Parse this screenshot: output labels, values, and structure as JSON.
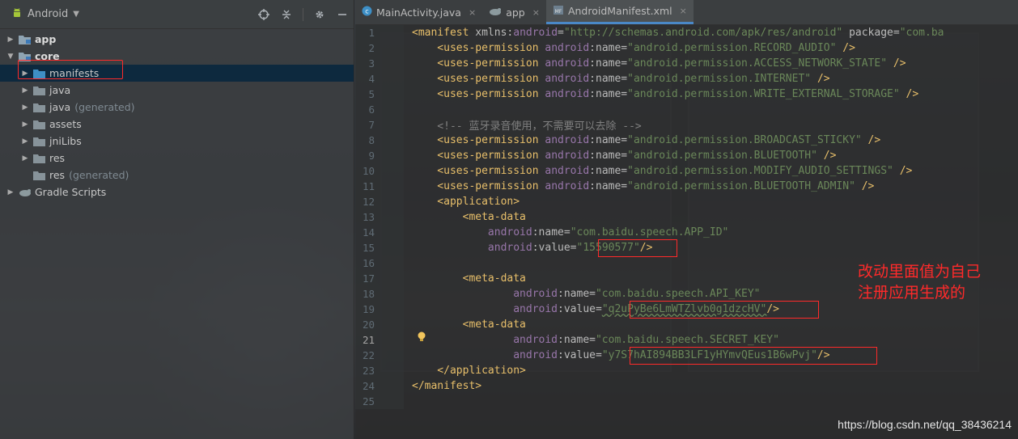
{
  "project": {
    "view_title": "Android",
    "tree": [
      {
        "label": "app",
        "bold": true,
        "expanded": false,
        "depth": 0
      },
      {
        "label": "core",
        "bold": true,
        "expanded": true,
        "depth": 0
      },
      {
        "label": "manifests",
        "depth": 1,
        "selected": true
      },
      {
        "label": "java",
        "depth": 1
      },
      {
        "label": "java",
        "muted": "(generated)",
        "depth": 1
      },
      {
        "label": "assets",
        "depth": 1
      },
      {
        "label": "jniLibs",
        "depth": 1
      },
      {
        "label": "res",
        "depth": 1
      },
      {
        "label": "res",
        "muted": "(generated)",
        "depth": 1,
        "no_arrow": true
      },
      {
        "label": "Gradle Scripts",
        "depth": 0
      }
    ]
  },
  "tabs": [
    {
      "label": "MainActivity.java"
    },
    {
      "label": "app"
    },
    {
      "label": "AndroidManifest.xml",
      "active": true
    }
  ],
  "editor": {
    "current_line": 21,
    "lines": [
      [
        [
          "t",
          "<manifest "
        ],
        [
          "an",
          "xmlns:"
        ],
        [
          "ns",
          "android"
        ],
        [
          "an",
          "="
        ],
        [
          "av",
          "\"http://schemas.android.com/apk/res/android\""
        ],
        [
          "an",
          " package="
        ],
        [
          "av",
          "\"com.ba"
        ]
      ],
      [
        [
          "t",
          "    <uses-permission "
        ],
        [
          "ns",
          "android"
        ],
        [
          "an",
          ":name="
        ],
        [
          "av",
          "\"android.permission.RECORD_AUDIO\""
        ],
        [
          "t",
          " />"
        ]
      ],
      [
        [
          "t",
          "    <uses-permission "
        ],
        [
          "ns",
          "android"
        ],
        [
          "an",
          ":name="
        ],
        [
          "av",
          "\"android.permission.ACCESS_NETWORK_STATE\""
        ],
        [
          "t",
          " />"
        ]
      ],
      [
        [
          "t",
          "    <uses-permission "
        ],
        [
          "ns",
          "android"
        ],
        [
          "an",
          ":name="
        ],
        [
          "av",
          "\"android.permission.INTERNET\""
        ],
        [
          "t",
          " />"
        ]
      ],
      [
        [
          "t",
          "    <uses-permission "
        ],
        [
          "ns",
          "android"
        ],
        [
          "an",
          ":name="
        ],
        [
          "av",
          "\"android.permission.WRITE_EXTERNAL_STORAGE\""
        ],
        [
          "t",
          " />"
        ]
      ],
      [],
      [
        [
          "cm",
          "    <!-- 蓝牙录音使用，不需要可以去除 -->"
        ]
      ],
      [
        [
          "t",
          "    <uses-permission "
        ],
        [
          "ns",
          "android"
        ],
        [
          "an",
          ":name="
        ],
        [
          "av",
          "\"android.permission.BROADCAST_STICKY\""
        ],
        [
          "t",
          " />"
        ]
      ],
      [
        [
          "t",
          "    <uses-permission "
        ],
        [
          "ns",
          "android"
        ],
        [
          "an",
          ":name="
        ],
        [
          "av",
          "\"android.permission.BLUETOOTH\""
        ],
        [
          "t",
          " />"
        ]
      ],
      [
        [
          "t",
          "    <uses-permission "
        ],
        [
          "ns",
          "android"
        ],
        [
          "an",
          ":name="
        ],
        [
          "av",
          "\"android.permission.MODIFY_AUDIO_SETTINGS\""
        ],
        [
          "t",
          " />"
        ]
      ],
      [
        [
          "t",
          "    <uses-permission "
        ],
        [
          "ns",
          "android"
        ],
        [
          "an",
          ":name="
        ],
        [
          "av",
          "\"android.permission.BLUETOOTH_ADMIN\""
        ],
        [
          "t",
          " />"
        ]
      ],
      [
        [
          "t",
          "    <application>"
        ]
      ],
      [
        [
          "t",
          "        <meta-data"
        ]
      ],
      [
        [
          "ns",
          "            android"
        ],
        [
          "an",
          ":name="
        ],
        [
          "av",
          "\"com.baidu.speech.APP_ID\""
        ]
      ],
      [
        [
          "ns",
          "            android"
        ],
        [
          "an",
          ":value="
        ],
        [
          "av",
          "\"15590577\""
        ],
        [
          "t",
          "/>"
        ]
      ],
      [],
      [
        [
          "t",
          "        <meta-data"
        ]
      ],
      [
        [
          "ns",
          "                android"
        ],
        [
          "an",
          ":name="
        ],
        [
          "av",
          "\"com.baidu.speech.API_KEY\""
        ]
      ],
      [
        [
          "ns",
          "                android"
        ],
        [
          "an",
          ":value="
        ],
        [
          "avw",
          "\"q2uPyBe6LmWTZlvb0g1dzcHV\""
        ],
        [
          "t",
          "/>"
        ]
      ],
      [
        [
          "t",
          "        <meta-data"
        ]
      ],
      [
        [
          "ns",
          "                android"
        ],
        [
          "an",
          ":name="
        ],
        [
          "av",
          "\"com.baidu.speech.SECRET_KEY\""
        ]
      ],
      [
        [
          "ns",
          "                android"
        ],
        [
          "an",
          ":value="
        ],
        [
          "av",
          "\"y7S7hAI894BB3LF1yHYmvQEus1B6wPvj\""
        ],
        [
          "t",
          "/>"
        ]
      ],
      [
        [
          "t",
          "    </application>"
        ]
      ],
      [
        [
          "t",
          "</manifest>"
        ]
      ],
      []
    ]
  },
  "annotation": "改动里面值为自己注册应用生成的",
  "watermark": "https://blog.csdn.net/qq_38436214",
  "colors": {
    "accent": "#4a88c7",
    "highlight_box": "#ff2a2a",
    "selection": "#0d293e"
  }
}
